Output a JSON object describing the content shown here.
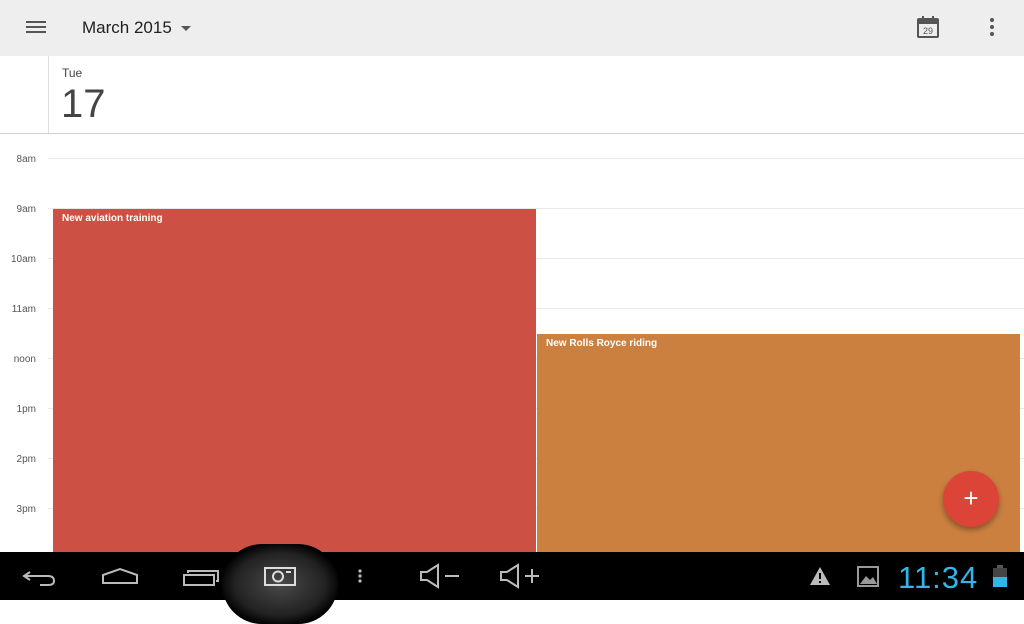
{
  "toolbar": {
    "month_label": "March 2015",
    "today_icon_day": "29",
    "menu_icon": "hamburger-menu-icon",
    "today_icon": "calendar-today-icon",
    "overflow_icon": "more-vert-icon"
  },
  "day": {
    "weekday": "Tue",
    "date": "17"
  },
  "hours": [
    "8am",
    "9am",
    "10am",
    "11am",
    "noon",
    "1pm",
    "2pm",
    "3pm"
  ],
  "events": [
    {
      "title": "New aviation training",
      "color": "#cc5043"
    },
    {
      "title": "New Rolls Royce riding",
      "color": "#cb803f"
    }
  ],
  "fab": {
    "label": "+",
    "color": "#db4437"
  },
  "systembar": {
    "time": "11:34",
    "icons": [
      "back-icon",
      "home-icon",
      "recent-apps-icon",
      "screenshot-icon",
      "menu-dots-icon",
      "volume-down-icon",
      "volume-up-icon",
      "warning-icon",
      "gallery-icon",
      "battery-icon"
    ],
    "clock_color": "#33b5e5"
  }
}
